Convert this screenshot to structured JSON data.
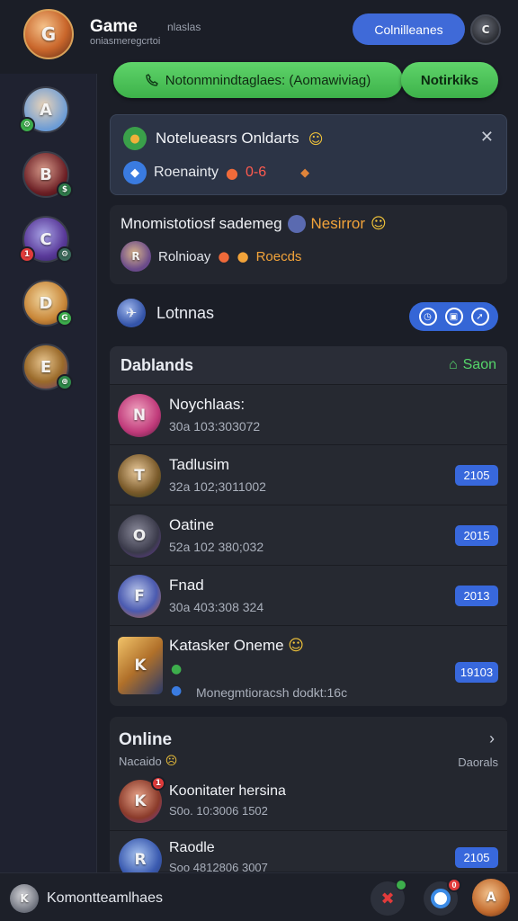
{
  "header": {
    "app_title": "Game",
    "title_tag": "nlaslas",
    "subtitle": "oniasmeregcrtoi",
    "primary_button": "Colnilleanes",
    "logo_initial": "G",
    "profile_initial": "C"
  },
  "action_bar": {
    "call_label": "Notonmnindtaglaes: (Aomawiviag)",
    "notify_label": "Notirkiks"
  },
  "sidebar": {
    "items": [
      {
        "initial": "A",
        "badge": "⚙",
        "badge_color": "#3dae4c",
        "badge_pos": "left"
      },
      {
        "initial": "B",
        "badge": "$",
        "badge_color": "#2f7a4a",
        "badge_pos": "right"
      },
      {
        "initial": "C",
        "badge": "1",
        "badge_color": "#e23b3b",
        "badge_pos": "left",
        "badge2": "⚙",
        "badge2_color": "#3a6a5a"
      },
      {
        "initial": "D",
        "badge": "G",
        "badge_color": "#3dae4c",
        "badge_pos": "right"
      },
      {
        "initial": "E",
        "badge": "⊕",
        "badge_color": "#2f8a4a",
        "badge_pos": "right"
      }
    ]
  },
  "notification": {
    "line1": "Notelueasrs Onldarts",
    "line2": "Roenainty",
    "line2_value": "0-6"
  },
  "event": {
    "line1": "Mnomistotiosf sademeg",
    "line1_accent": "Nesirror",
    "line2": "Rolnioay",
    "line2_accent": "Roecds"
  },
  "section": {
    "title": "Lotnnas"
  },
  "friends": {
    "header_title": "Dablands",
    "header_action": "Saon",
    "rows": [
      {
        "name": "Noychlaas:",
        "status": "30a 103:303072",
        "level": "",
        "initial": "N"
      },
      {
        "name": "Tadlusim",
        "status": "32a 102;3011002",
        "level": "2105",
        "initial": "T"
      },
      {
        "name": "Oatine",
        "status": "52a 102 380;032",
        "level": "2015",
        "initial": "O"
      },
      {
        "name": "Fnad",
        "status": "30a 403:308 324",
        "level": "2013",
        "initial": "F"
      },
      {
        "name": "Katasker Oneme",
        "status": "Monegmtioracsh dodkt:16c",
        "level": "19103",
        "initial": "K"
      }
    ]
  },
  "online": {
    "title": "Online",
    "subtitle": "Nacaido",
    "right_label": "Daorals",
    "rows": [
      {
        "name": "Koonitater hersina",
        "status": "S0o. 10:3006 1502",
        "initial": "K",
        "badge": "1"
      },
      {
        "name": "Raodle",
        "status": "Soo 4812806 3007",
        "initial": "R",
        "level": "2105"
      }
    ]
  },
  "bottom": {
    "status_text": "Komontteamlhaes",
    "me_initial": "K",
    "notif_count": "0",
    "right_initial": "A"
  },
  "colors": {
    "accent_blue": "#3f6ad8",
    "accent_green": "#4cc35a",
    "panel": "#262931"
  }
}
